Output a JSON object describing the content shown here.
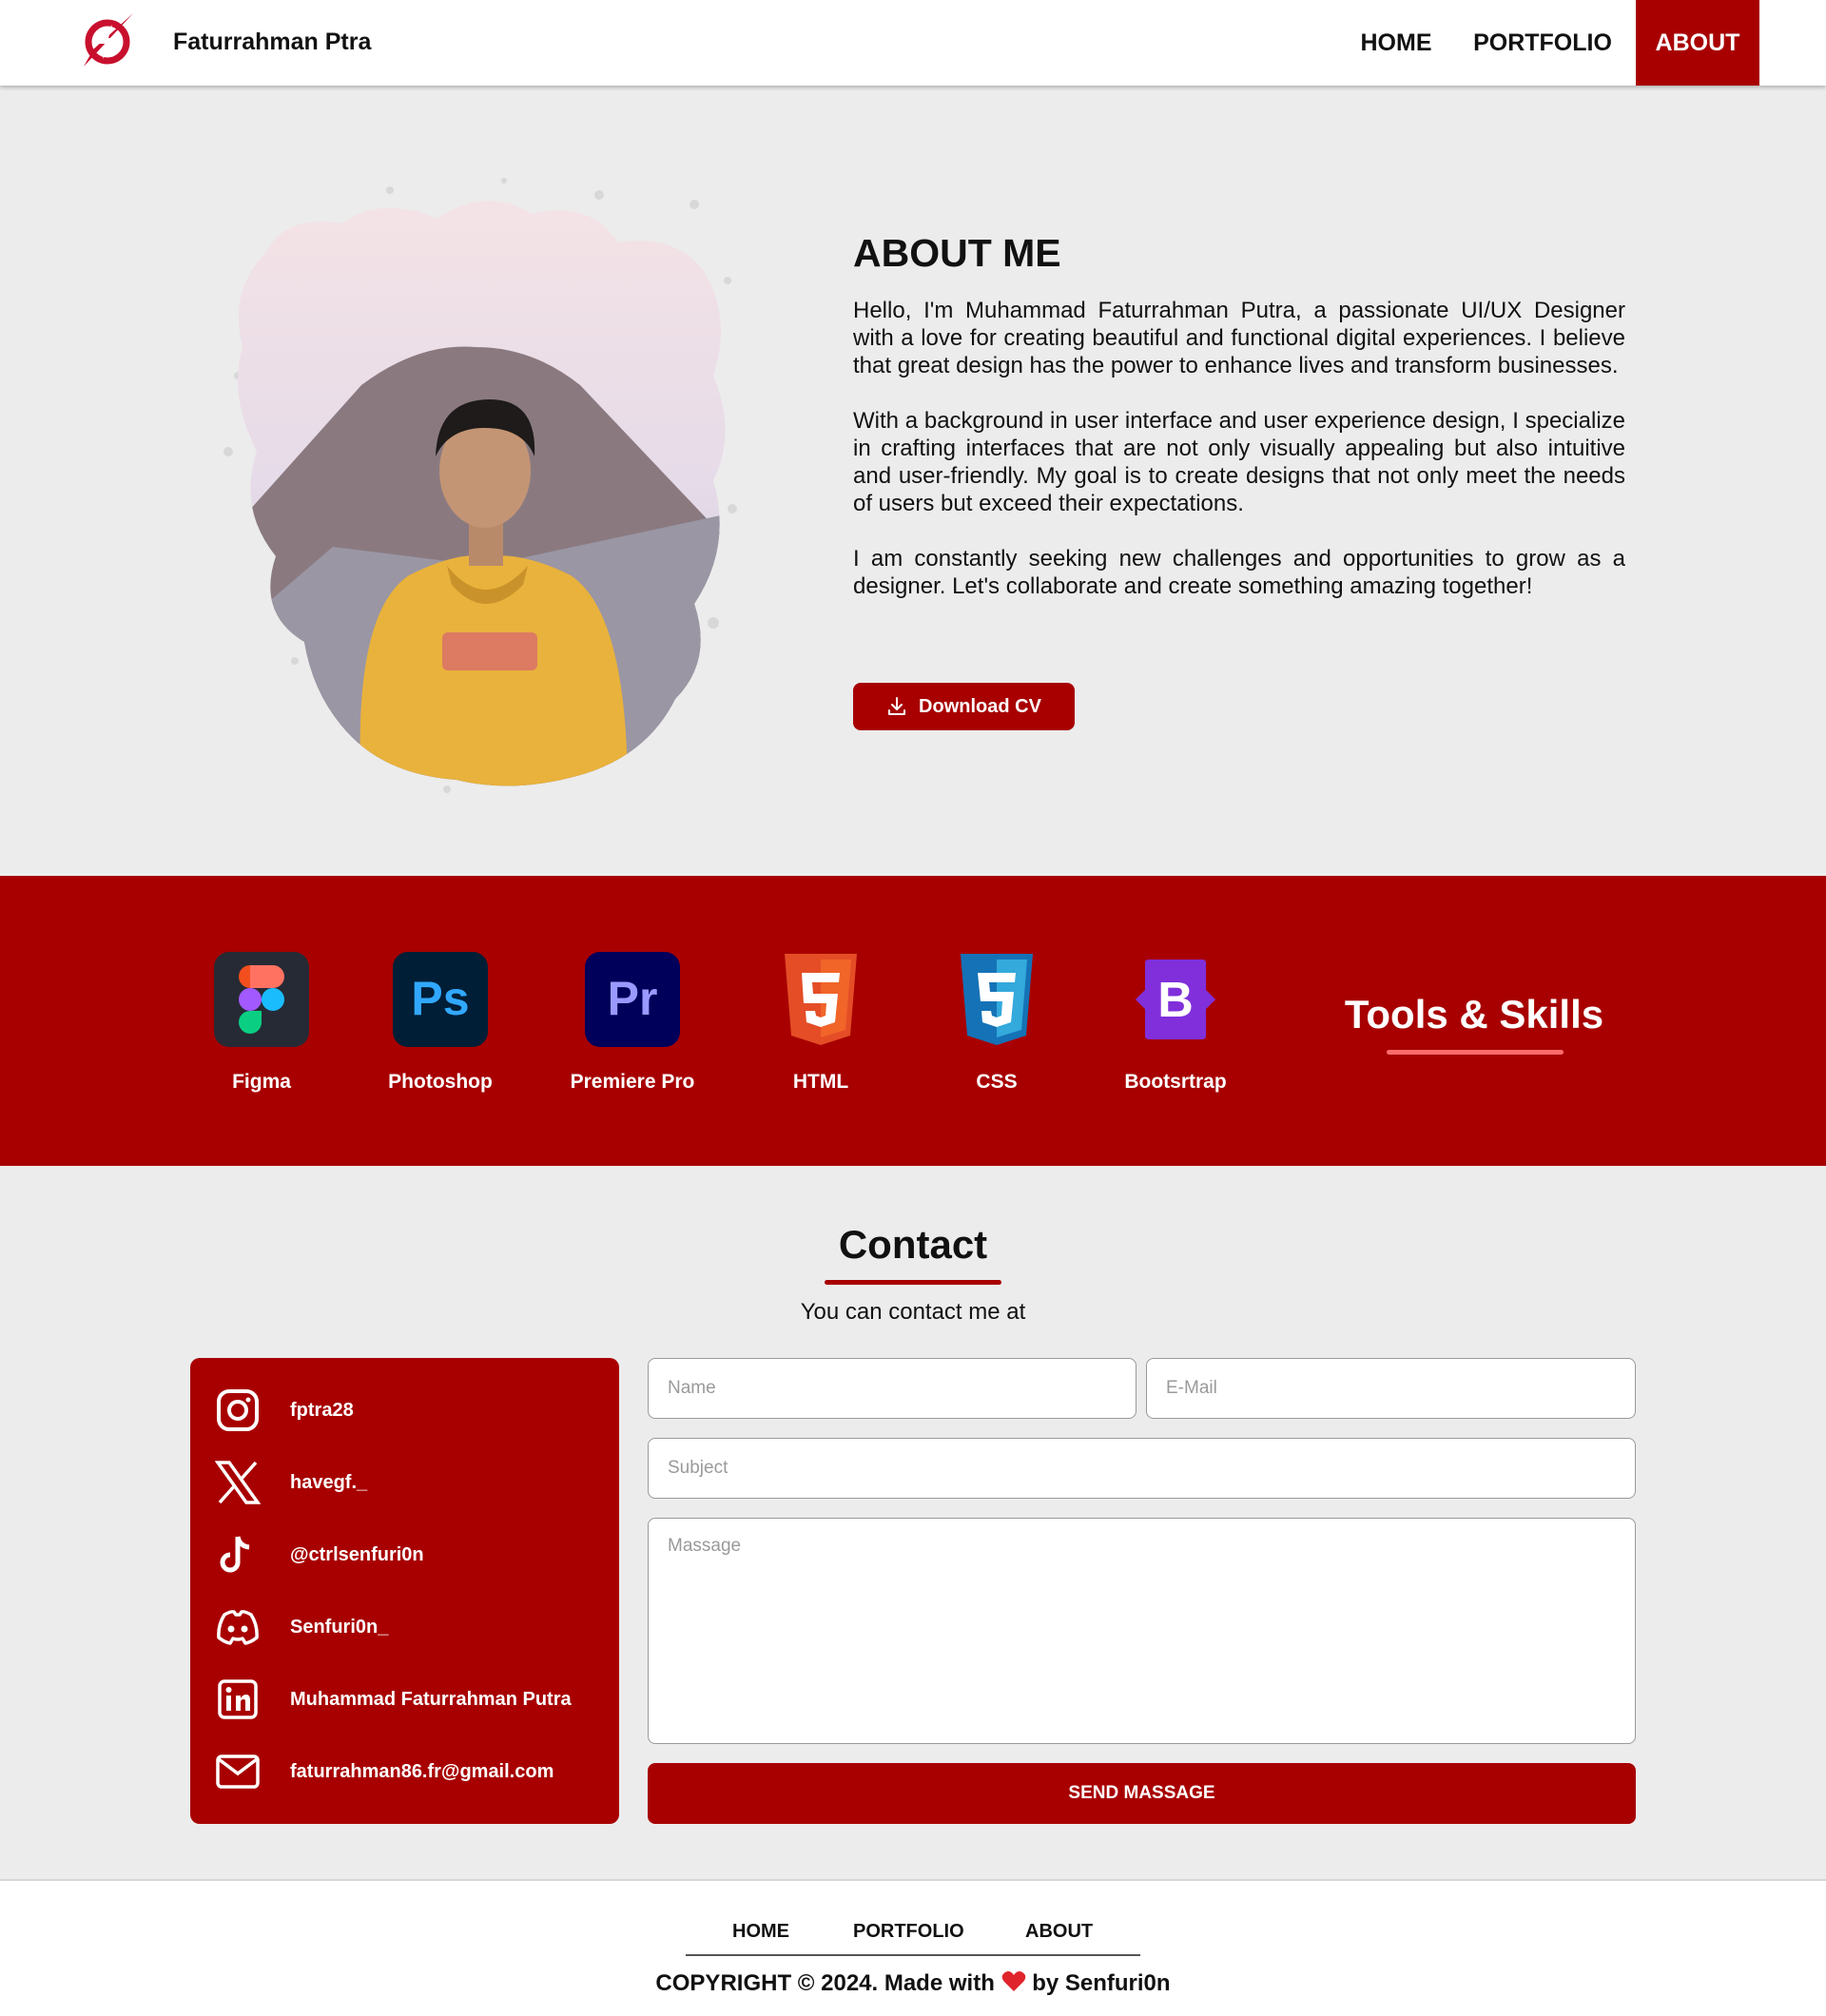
{
  "header": {
    "brand": "Faturrahman Ptra",
    "nav": {
      "home": "HOME",
      "portfolio": "PORTFOLIO",
      "about": "ABOUT"
    },
    "active_nav": "ABOUT",
    "accent_color": "#a80000"
  },
  "about": {
    "title": "ABOUT ME",
    "paragraphs": [
      "Hello, I'm Muhammad Faturrahman Putra, a passionate UI/UX Designer with a love for creating beautiful and functional digital experiences. I believe that great design has the power to enhance lives and transform businesses.",
      "With a background in user interface and user experience design, I specialize in crafting interfaces that are not only visually appealing but also intuitive and user-friendly. My goal is to create designs that not only meet the needs of users but exceed their expectations.",
      "I am constantly seeking new challenges and opportunities to grow as a designer. Let's collaborate and create something amazing together!"
    ],
    "download_label": "Download CV"
  },
  "skills": {
    "title": "Tools & Skills",
    "items": [
      {
        "label": "Figma",
        "icon": "figma-icon"
      },
      {
        "label": "Photoshop",
        "icon": "photoshop-icon"
      },
      {
        "label": "Premiere Pro",
        "icon": "premiere-pro-icon"
      },
      {
        "label": "HTML",
        "icon": "html5-icon"
      },
      {
        "label": "CSS",
        "icon": "css3-icon"
      },
      {
        "label": "Bootsrtrap",
        "icon": "bootstrap-icon"
      }
    ]
  },
  "contact": {
    "title": "Contact",
    "subtitle": "You can contact me at",
    "socials": [
      {
        "icon": "instagram-icon",
        "text": "fptra28"
      },
      {
        "icon": "x-twitter-icon",
        "text": "havegf._"
      },
      {
        "icon": "tiktok-icon",
        "text": "@ctrlsenfuri0n"
      },
      {
        "icon": "discord-icon",
        "text": "Senfuri0n_"
      },
      {
        "icon": "linkedin-icon",
        "text": "Muhammad Faturrahman Putra"
      },
      {
        "icon": "mail-icon",
        "text": "faturrahman86.fr@gmail.com"
      }
    ],
    "form": {
      "name_placeholder": "Name",
      "email_placeholder": "E-Mail",
      "subject_placeholder": "Subject",
      "message_placeholder": "Massage",
      "send_label": "SEND MASSAGE"
    }
  },
  "footer": {
    "nav": {
      "home": "HOME",
      "portfolio": "PORTFOLIO",
      "about": "ABOUT"
    },
    "copyright_prefix": "COPYRIGHT © 2024. Made with",
    "copyright_suffix": "by Senfuri0n",
    "heart_icon": "heart-icon"
  }
}
